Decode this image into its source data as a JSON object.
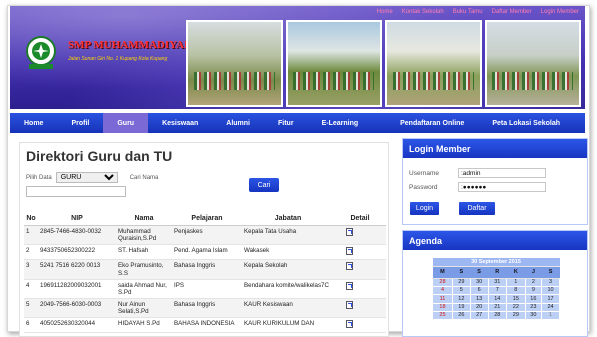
{
  "top_links": [
    "Home",
    "Kontak Sekolah",
    "Buku Tamu",
    "Daftar Member",
    "Login Member"
  ],
  "site": {
    "name": "SMP MUHAMMADIYAH KUPANG",
    "tagline": "Jalan Sunan Giri No. 1 Kupang Kota Kupang"
  },
  "nav": [
    {
      "label": "Home"
    },
    {
      "label": "Profil"
    },
    {
      "label": "Guru"
    },
    {
      "label": "Kesiswaan"
    },
    {
      "label": "Alumni"
    },
    {
      "label": "Fitur"
    },
    {
      "label": "E-Learning"
    },
    {
      "label": "Pendaftaran Online"
    },
    {
      "label": "Peta Lokasi Sekolah"
    }
  ],
  "main": {
    "title": "Direktori Guru dan TU",
    "filter_label": "Pilih Data",
    "filter_value": "GURU",
    "name_label": "Cari Nama",
    "search_button": "Cari",
    "columns": [
      "No",
      "NIP",
      "Nama",
      "Pelajaran",
      "Jabatan",
      "Detail"
    ],
    "rows": [
      {
        "no": "1",
        "nip": "2845-7466-4830-0032",
        "nama": "Muhammad Quraisin,S.Pd",
        "pelajaran": "Penjaskes",
        "jabatan": "Kepala Tata Usaha"
      },
      {
        "no": "2",
        "nip": "9433750652300222",
        "nama": "ST. Hafsah",
        "pelajaran": "Pend. Agama Islam",
        "jabatan": "Wakasek"
      },
      {
        "no": "3",
        "nip": "5241 7516 6220 0013",
        "nama": "Eko Pramusinto, S.S",
        "pelajaran": "Bahasa Inggris",
        "jabatan": "Kepala Sekolah"
      },
      {
        "no": "4",
        "nip": "196911282009032001",
        "nama": "saida Ahmad Nur, S.Pd",
        "pelajaran": "IPS",
        "jabatan": "Bendahara komite/walikelas7C"
      },
      {
        "no": "5",
        "nip": "2049-7566-6030-0003",
        "nama": "Nur Ainun Selati,S.Pd",
        "pelajaran": "Bahasa Inggris",
        "jabatan": "KAUR Kesiswaan"
      },
      {
        "no": "6",
        "nip": "4050252630320044",
        "nama": "HIDAYAH S.Pd",
        "pelajaran": "BAHASA INDONESIA",
        "jabatan": "KAUR KURIKULUM DAN"
      }
    ]
  },
  "login": {
    "title": "Login Member",
    "username_label": "Username",
    "username_value": ":admin",
    "password_label": "Password",
    "password_value": ":●●●●●●",
    "login_button": "Login",
    "register_button": "Daftar"
  },
  "agenda": {
    "title": "Agenda",
    "month": "30 September 2015",
    "days": [
      "M",
      "S",
      "S",
      "R",
      "K",
      "J",
      "S"
    ],
    "weeks": [
      [
        "",
        "",
        "1",
        "2",
        "3",
        "4",
        "5"
      ],
      [
        "28",
        "29",
        "30",
        "31",
        "1",
        "2",
        "3"
      ],
      [
        "4",
        "5",
        "6",
        "7",
        "8",
        "9",
        "10"
      ],
      [
        "11",
        "12",
        "13",
        "14",
        "15",
        "16",
        "17"
      ],
      [
        "18",
        "19",
        "20",
        "21",
        "22",
        "23",
        "24"
      ],
      [
        "25",
        "26",
        "27",
        "28",
        "29",
        "30",
        "1"
      ]
    ]
  }
}
